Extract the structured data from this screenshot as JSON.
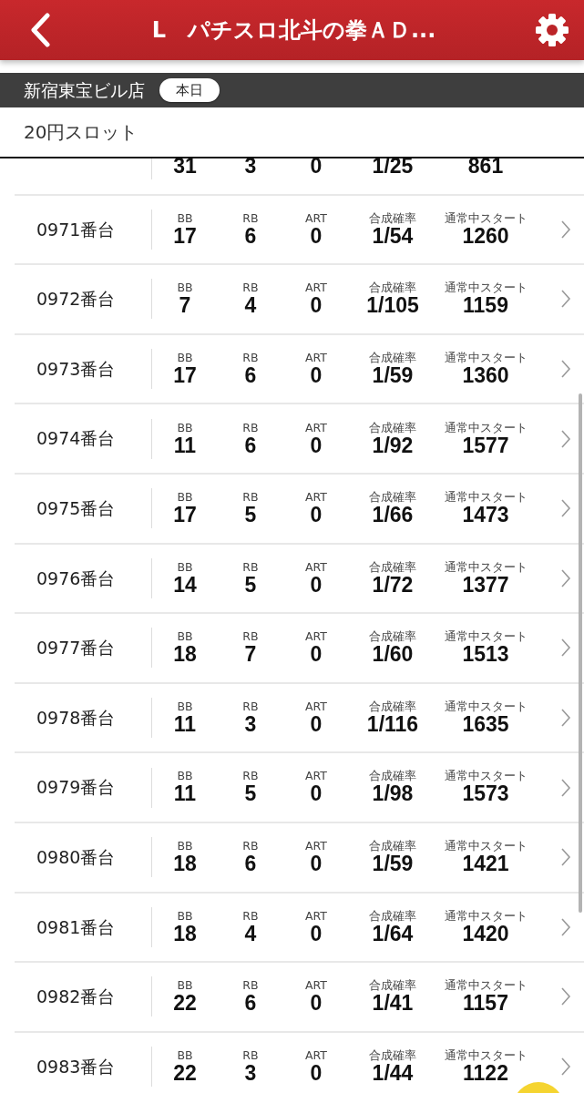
{
  "header": {
    "title": "L　パチスロ北斗の拳ＡＤ..."
  },
  "store_bar": {
    "store": "新宿東宝ビル店",
    "day": "本日"
  },
  "section": {
    "title": "20円スロット"
  },
  "partial_row": {
    "values": [
      "31",
      "3",
      "0",
      "1/25",
      "861"
    ]
  },
  "rows": [
    {
      "machine": "0971番台",
      "labels": [
        "BB",
        "RB",
        "ART",
        "合成確率",
        "通常中スタート"
      ],
      "values": [
        "17",
        "6",
        "0",
        "1/54",
        "1260"
      ]
    },
    {
      "machine": "0972番台",
      "labels": [
        "BB",
        "RB",
        "ART",
        "合成確率",
        "通常中スタート"
      ],
      "values": [
        "7",
        "4",
        "0",
        "1/105",
        "1159"
      ]
    },
    {
      "machine": "0973番台",
      "labels": [
        "BB",
        "RB",
        "ART",
        "合成確率",
        "通常中スタート"
      ],
      "values": [
        "17",
        "6",
        "0",
        "1/59",
        "1360"
      ]
    },
    {
      "machine": "0974番台",
      "labels": [
        "BB",
        "RB",
        "ART",
        "合成確率",
        "通常中スタート"
      ],
      "values": [
        "11",
        "6",
        "0",
        "1/92",
        "1577"
      ]
    },
    {
      "machine": "0975番台",
      "labels": [
        "BB",
        "RB",
        "ART",
        "合成確率",
        "通常中スタート"
      ],
      "values": [
        "17",
        "5",
        "0",
        "1/66",
        "1473"
      ]
    },
    {
      "machine": "0976番台",
      "labels": [
        "BB",
        "RB",
        "ART",
        "合成確率",
        "通常中スタート"
      ],
      "values": [
        "14",
        "5",
        "0",
        "1/72",
        "1377"
      ]
    },
    {
      "machine": "0977番台",
      "labels": [
        "BB",
        "RB",
        "ART",
        "合成確率",
        "通常中スタート"
      ],
      "values": [
        "18",
        "7",
        "0",
        "1/60",
        "1513"
      ]
    },
    {
      "machine": "0978番台",
      "labels": [
        "BB",
        "RB",
        "ART",
        "合成確率",
        "通常中スタート"
      ],
      "values": [
        "11",
        "3",
        "0",
        "1/116",
        "1635"
      ]
    },
    {
      "machine": "0979番台",
      "labels": [
        "BB",
        "RB",
        "ART",
        "合成確率",
        "通常中スタート"
      ],
      "values": [
        "11",
        "5",
        "0",
        "1/98",
        "1573"
      ]
    },
    {
      "machine": "0980番台",
      "labels": [
        "BB",
        "RB",
        "ART",
        "合成確率",
        "通常中スタート"
      ],
      "values": [
        "18",
        "6",
        "0",
        "1/59",
        "1421"
      ]
    },
    {
      "machine": "0981番台",
      "labels": [
        "BB",
        "RB",
        "ART",
        "合成確率",
        "通常中スタート"
      ],
      "values": [
        "18",
        "4",
        "0",
        "1/64",
        "1420"
      ]
    },
    {
      "machine": "0982番台",
      "labels": [
        "BB",
        "RB",
        "ART",
        "合成確率",
        "通常中スタート"
      ],
      "values": [
        "22",
        "6",
        "0",
        "1/41",
        "1157"
      ]
    },
    {
      "machine": "0983番台",
      "labels": [
        "BB",
        "RB",
        "ART",
        "合成確率",
        "通常中スタート"
      ],
      "values": [
        "22",
        "3",
        "0",
        "1/44",
        "1122"
      ]
    }
  ]
}
